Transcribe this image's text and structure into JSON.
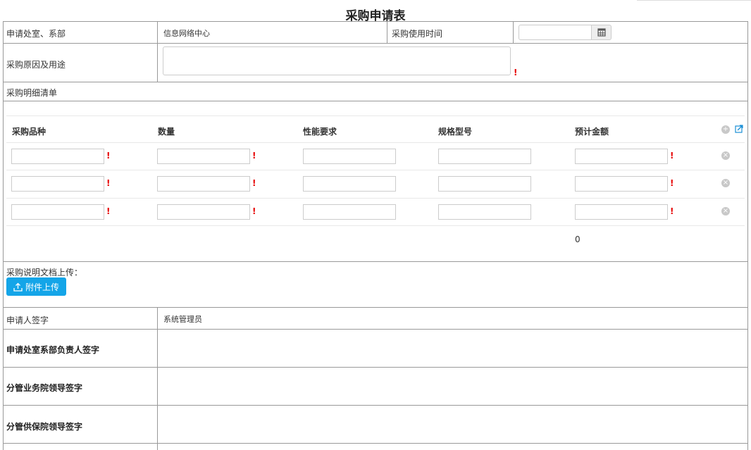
{
  "form": {
    "title": "采购申请表"
  },
  "fields": {
    "dept_label": "申请处室、系部",
    "dept_value": "信息网络中心",
    "time_label": "采购使用时间",
    "time_value": "",
    "reason_label": "采购原因及用途",
    "reason_value": "",
    "detail_label": "采购明细清单"
  },
  "detail_table": {
    "columns": [
      "采购品种",
      "数量",
      "性能要求",
      "规格型号",
      "预计金额"
    ],
    "rows": [
      [
        "",
        "",
        "",
        "",
        ""
      ],
      [
        "",
        "",
        "",
        "",
        ""
      ],
      [
        "",
        "",
        "",
        "",
        ""
      ]
    ],
    "required_mark": "!",
    "total": "0"
  },
  "upload": {
    "label": "采购说明文档上传：",
    "button": "附件上传"
  },
  "signatures": {
    "applicant_label": "申请人签字",
    "applicant_value": "系统管理员",
    "dept_head_label": "申请处室系部负责人签字",
    "business_leader_label": "分管业务院领导签字",
    "support_leader_label": "分管供保院领导签字"
  },
  "icons": {
    "calendar": "calendar-icon",
    "add": "add-row-icon",
    "export": "export-icon",
    "delete": "delete-row-icon",
    "upload": "upload-icon"
  },
  "colors": {
    "accent": "#14a5e8",
    "required": "#e60000",
    "border": "#999999"
  }
}
